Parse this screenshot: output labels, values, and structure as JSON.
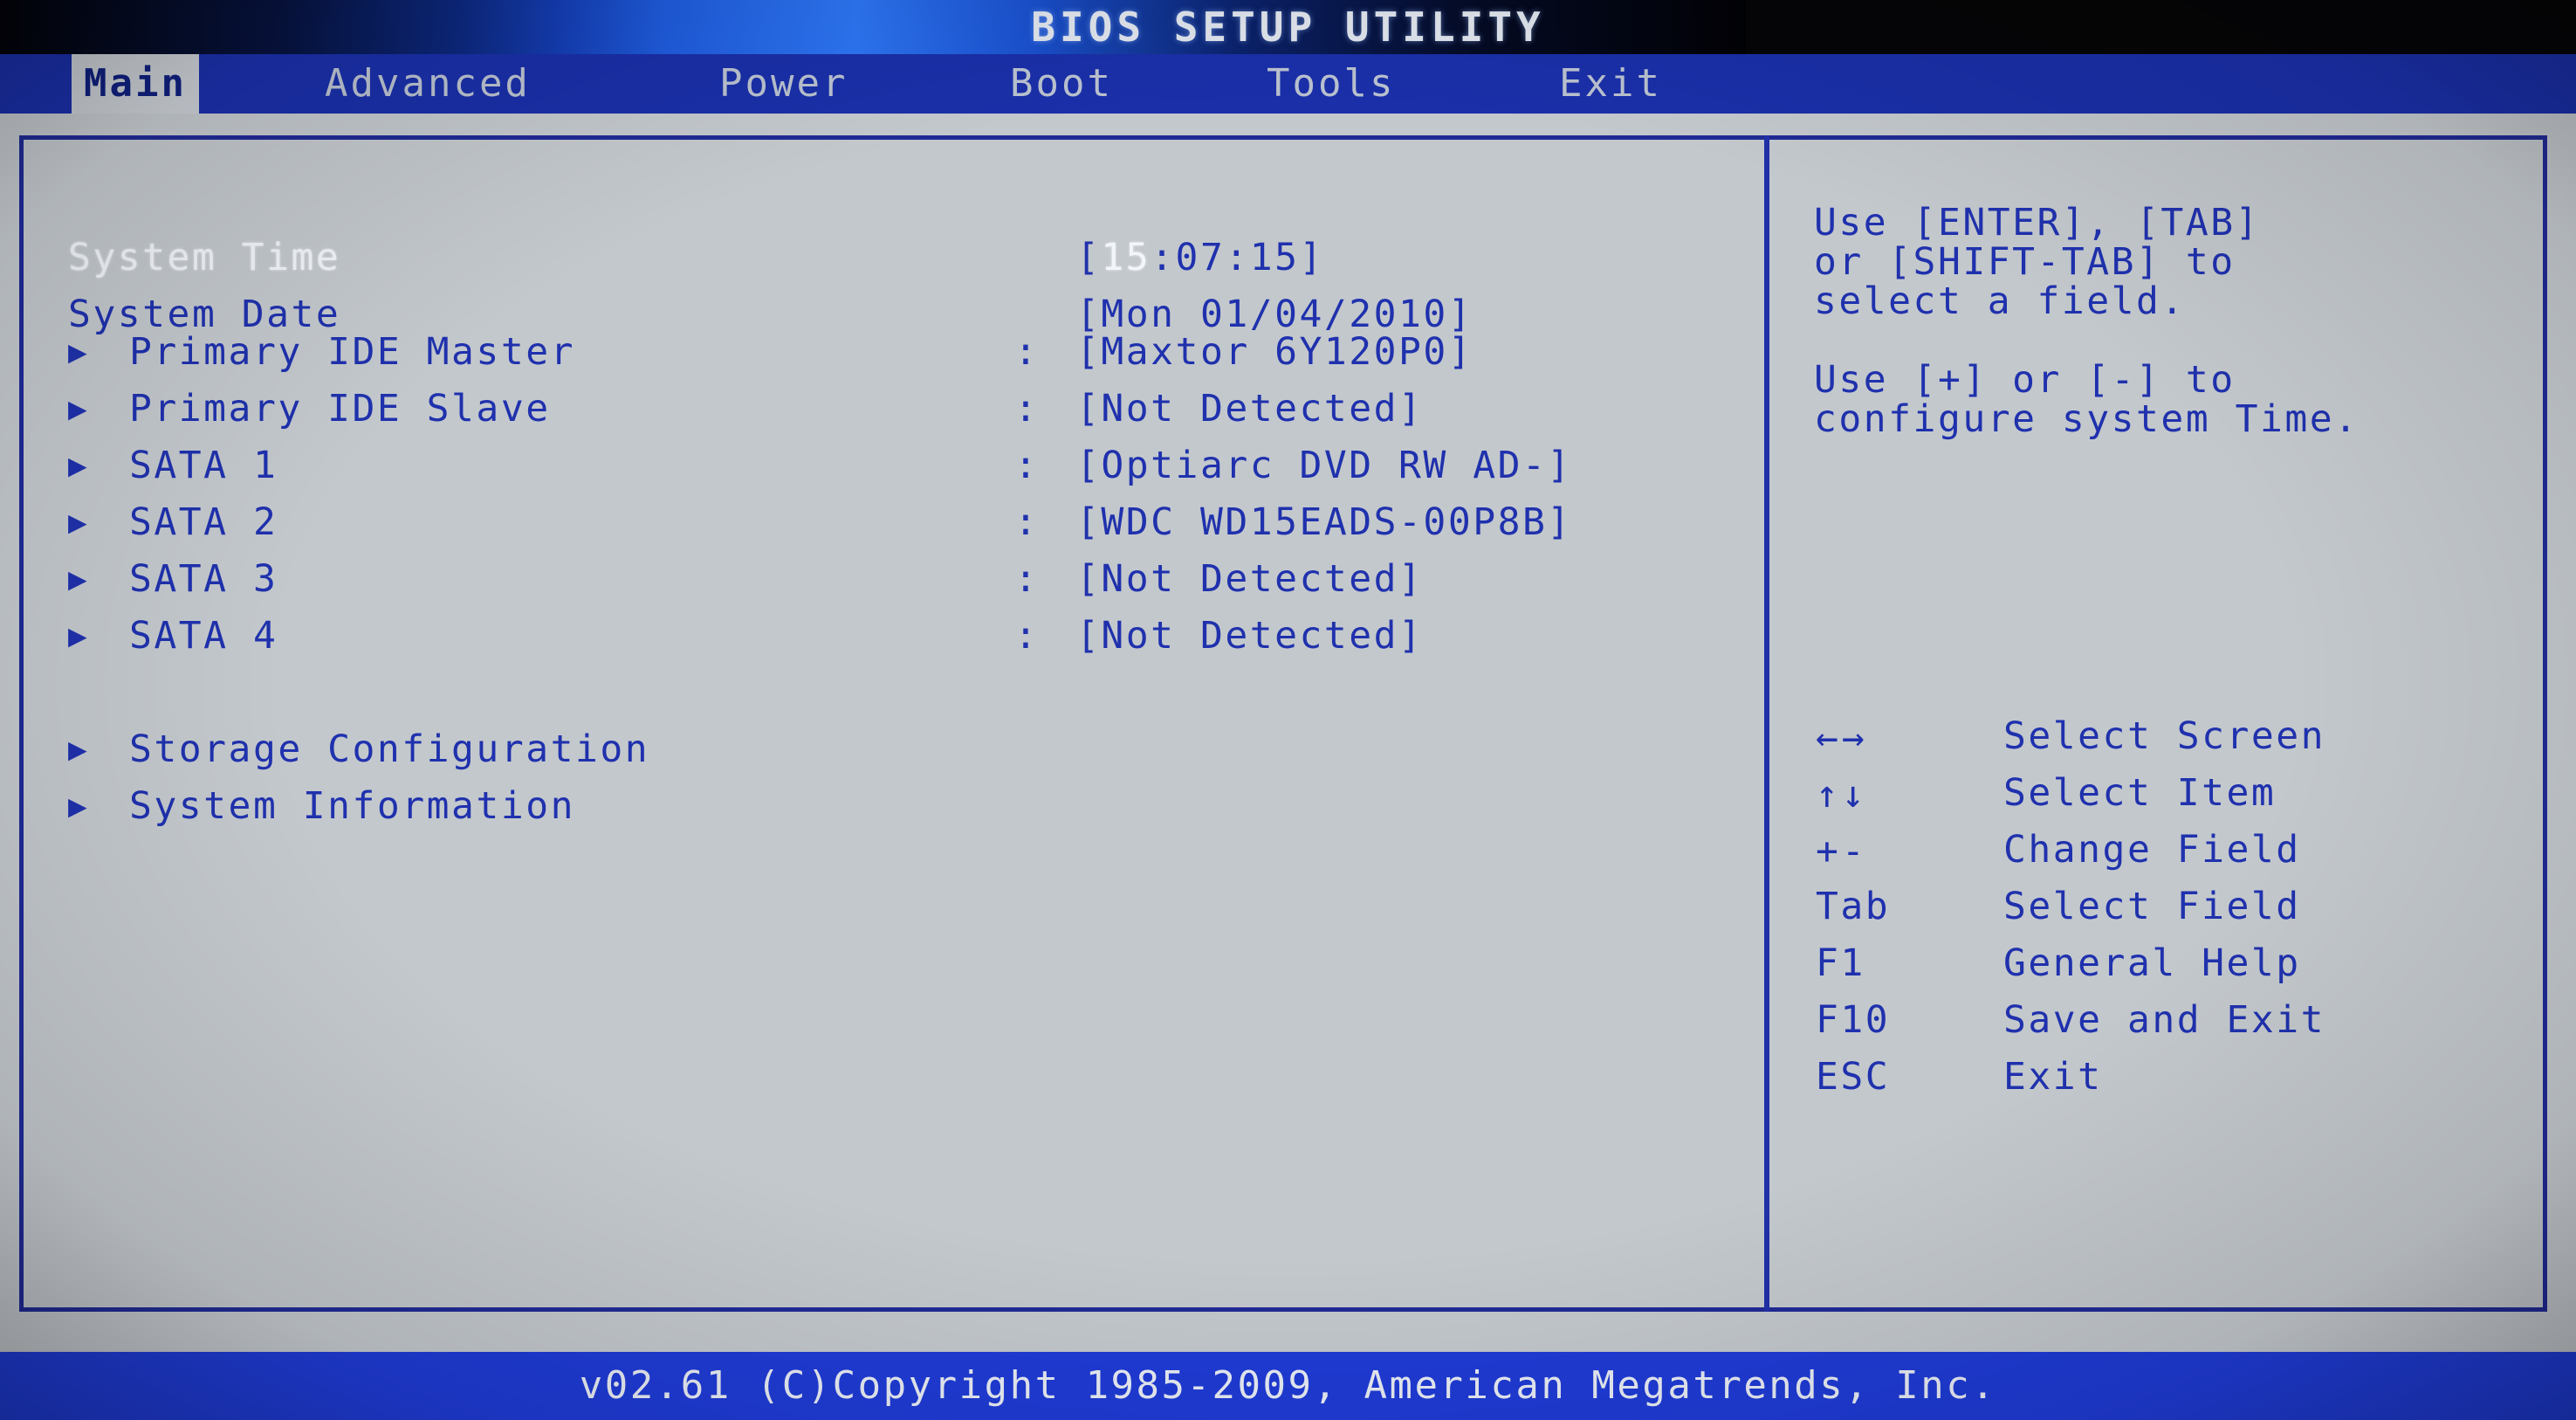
{
  "title": "BIOS SETUP UTILITY",
  "menu": {
    "items": [
      {
        "label": "Main",
        "active": true
      },
      {
        "label": "Advanced",
        "active": false
      },
      {
        "label": "Power",
        "active": false
      },
      {
        "label": "Boot",
        "active": false
      },
      {
        "label": "Tools",
        "active": false
      },
      {
        "label": "Exit",
        "active": false
      }
    ]
  },
  "main": {
    "system_time": {
      "label": "System Time",
      "value_prefix": "[",
      "value_highlight": "15",
      "value_rest": ":07:15]",
      "selected": true
    },
    "system_date": {
      "label": "System Date",
      "value": "[Mon 01/04/2010]",
      "selected": false
    },
    "devices": [
      {
        "arrow": "▶",
        "label": "Primary IDE Master",
        "colon": ":",
        "value": "[Maxtor 6Y120P0]"
      },
      {
        "arrow": "▶",
        "label": "Primary IDE Slave",
        "colon": ":",
        "value": "[Not Detected]"
      },
      {
        "arrow": "▶",
        "label": "SATA 1",
        "colon": ":",
        "value": "[Optiarc DVD RW AD-]"
      },
      {
        "arrow": "▶",
        "label": "SATA 2",
        "colon": ":",
        "value": "[WDC WD15EADS-00P8B]"
      },
      {
        "arrow": "▶",
        "label": "SATA 3",
        "colon": ":",
        "value": "[Not Detected]"
      },
      {
        "arrow": "▶",
        "label": "SATA 4",
        "colon": ":",
        "value": "[Not Detected]"
      }
    ],
    "submenus": [
      {
        "arrow": "▶",
        "label": "Storage Configuration"
      },
      {
        "arrow": "▶",
        "label": "System Information"
      }
    ]
  },
  "help": {
    "paragraph1": [
      "Use [ENTER], [TAB]",
      "or [SHIFT-TAB] to",
      "select a field."
    ],
    "paragraph2": [
      "Use [+] or [-] to",
      "configure system Time."
    ],
    "keys": [
      {
        "glyph": "←→",
        "desc": "Select Screen"
      },
      {
        "glyph": "↑↓",
        "desc": "Select Item"
      },
      {
        "glyph": "+-",
        "desc": "Change Field"
      },
      {
        "glyph": "Tab",
        "desc": "Select Field"
      },
      {
        "glyph": "F1",
        "desc": "General Help"
      },
      {
        "glyph": "F10",
        "desc": "Save and Exit"
      },
      {
        "glyph": "ESC",
        "desc": "Exit"
      }
    ]
  },
  "footer": {
    "text": "v02.61 (C)Copyright 1985-2009, American Megatrends, Inc."
  },
  "colors": {
    "panel_bg": "#c3c8cd",
    "text_blue": "#1f31ad",
    "border_blue": "#202a95",
    "menubar_blue": "#1a2fa8",
    "footer_blue": "#1f3bd6",
    "highlight_bg": "#c9ced4",
    "highlight_fg": "#10207e",
    "selected_text": "#f2f5fa"
  }
}
